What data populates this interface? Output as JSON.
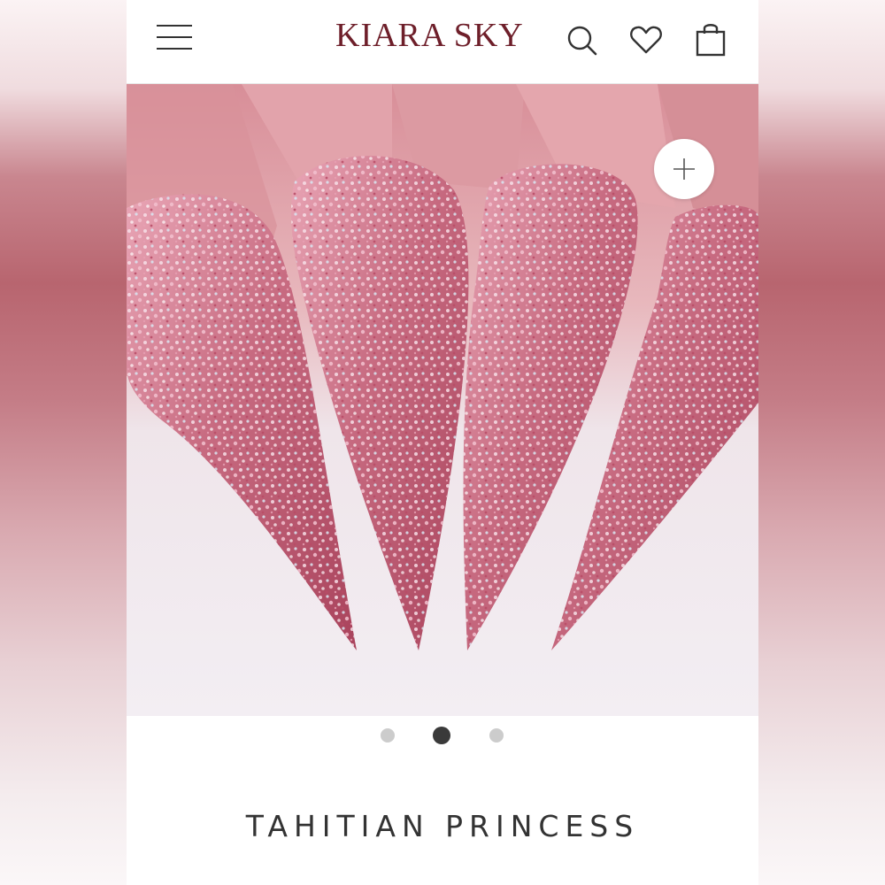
{
  "header": {
    "brand": "KIARA SKY",
    "menu_icon": "hamburger-menu-icon",
    "search_icon": "search-icon",
    "wishlist_icon": "heart-icon",
    "cart_icon": "shopping-bag-icon"
  },
  "gallery": {
    "image_subject": "pink glitter stiletto nails",
    "zoom_icon": "plus-icon",
    "slides_total": 3,
    "active_slide": 2
  },
  "product": {
    "title": "TAHITIAN PRINCESS"
  },
  "colors": {
    "brand": "#6e1f2a",
    "active_dot": "#3a3a3a",
    "inactive_dot": "#cccccc"
  }
}
